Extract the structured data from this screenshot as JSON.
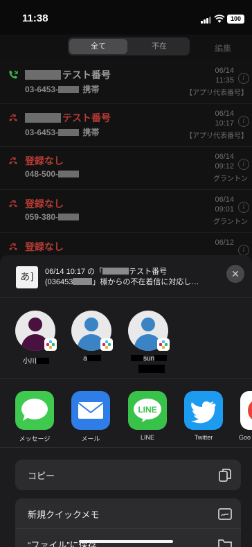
{
  "status_bar": {
    "time": "11:38",
    "battery": "100"
  },
  "header": {
    "tab_all": "全て",
    "tab_missed": "不在",
    "edit": "編集"
  },
  "calls": [
    {
      "name_suffix": "テスト番号",
      "number": "03-6453-",
      "number_type": "携帯",
      "date": "06/14",
      "time": "11:35",
      "sub": "【アプリ代表番号】",
      "missed": false,
      "redacted_name": true
    },
    {
      "name_suffix": "テスト番号",
      "number": "03-6453-",
      "number_type": "携帯",
      "date": "06/14",
      "time": "10:17",
      "sub": "【アプリ代表番号】",
      "missed": true,
      "redacted_name": true
    },
    {
      "name_suffix": "登録なし",
      "number": "048-500-",
      "number_type": "",
      "date": "06/14",
      "time": "09:12",
      "sub": "グラントン",
      "missed": true,
      "redacted_name": false
    },
    {
      "name_suffix": "登録なし",
      "number": "059-380-",
      "number_type": "",
      "date": "06/14",
      "time": "09:01",
      "sub": "グラントン",
      "missed": true,
      "redacted_name": false
    },
    {
      "name_suffix": "登録なし",
      "number": "",
      "number_type": "",
      "date": "06/12",
      "time": "",
      "sub": "",
      "missed": true,
      "redacted_name": false
    }
  ],
  "share": {
    "thumb": "あ]",
    "title_prefix": "06/14 10:17 の「",
    "title_mid": "テスト番号",
    "title_line2_prefix": "(036453",
    "title_line2_suffix": "」様からの不在着信に対応し…",
    "close": "✕"
  },
  "contacts": [
    {
      "name": "小川",
      "style": "person"
    },
    {
      "name": "a",
      "style": "default"
    },
    {
      "name": "sun",
      "style": "default"
    }
  ],
  "apps": [
    {
      "label": "メッセージ",
      "icon": "messages-icon"
    },
    {
      "label": "メール",
      "icon": "mail-icon"
    },
    {
      "label": "LINE",
      "icon": "line-icon",
      "text": "LINE"
    },
    {
      "label": "Twitter",
      "icon": "twitter-icon"
    },
    {
      "label": "Goo",
      "icon": "google-icon"
    }
  ],
  "actions": {
    "copy": "コピー",
    "quick_note": "新規クイックメモ",
    "save_files": "“ファイル”に保存"
  },
  "colors": {
    "missed": "#b53b34",
    "messages": "#3fc94f",
    "mail": "#2f7de6",
    "line": "#39c24a",
    "twitter": "#1d9bf0",
    "slack_badge": [
      "#e01e5a",
      "#36c5f0",
      "#2eb67d",
      "#ecb22e"
    ]
  }
}
